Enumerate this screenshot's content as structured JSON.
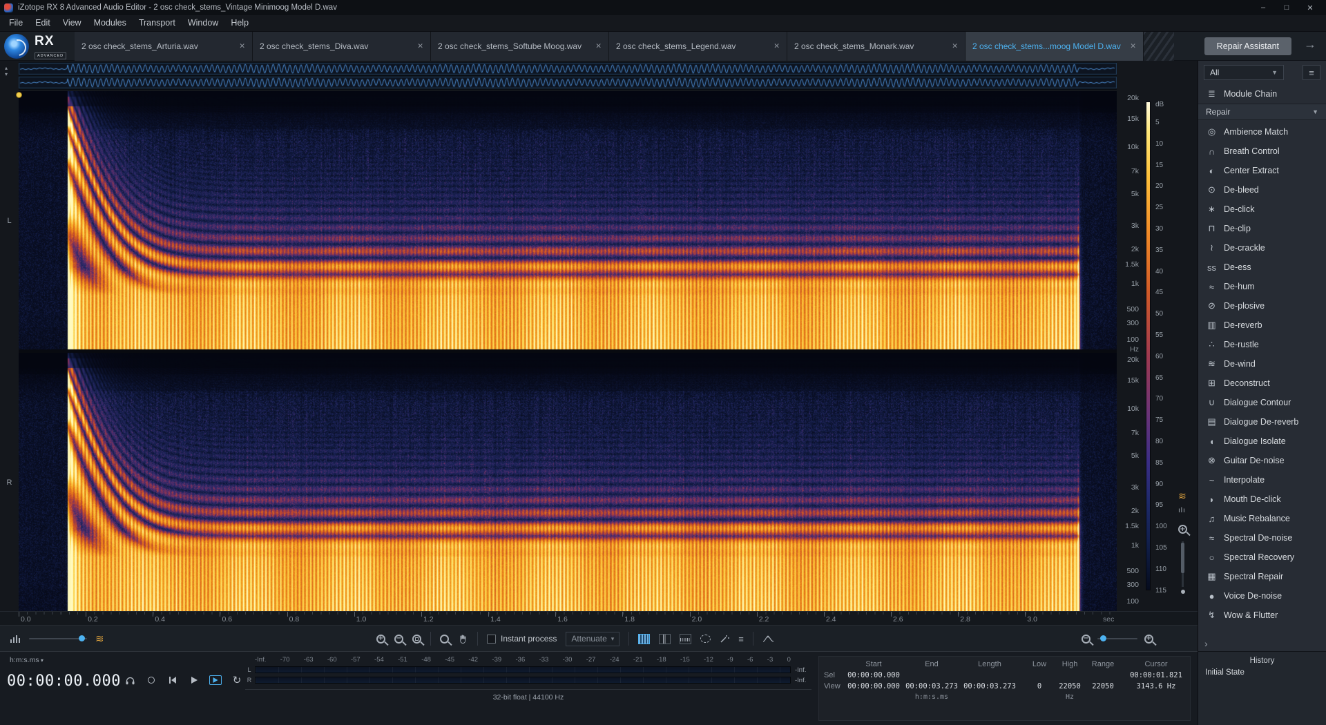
{
  "window": {
    "title": "iZotope RX 8 Advanced Audio Editor - 2 osc check_stems_Vintage Minimoog Model D.wav",
    "controls": {
      "minimize": "–",
      "maximize": "□",
      "close": "✕"
    }
  },
  "menu": {
    "items": [
      "File",
      "Edit",
      "View",
      "Modules",
      "Transport",
      "Window",
      "Help"
    ]
  },
  "brand": {
    "name": "RX",
    "sub": "ADVANCED"
  },
  "tabbar": {
    "close_glyph": "✕",
    "tabs": [
      {
        "label": "2 osc check_stems_Arturia.wav",
        "active": false
      },
      {
        "label": "2 osc check_stems_Diva.wav",
        "active": false
      },
      {
        "label": "2 osc check_stems_Softube Moog.wav",
        "active": false
      },
      {
        "label": "2 osc check_stems_Legend.wav",
        "active": false
      },
      {
        "label": "2 osc check_stems_Monark.wav",
        "active": false
      },
      {
        "label": "2 osc check_stems...moog Model D.wav",
        "active": true
      }
    ],
    "repair_assistant_label": "Repair Assistant"
  },
  "spectrogram": {
    "channel_labels": [
      "L",
      "R"
    ],
    "freq_ticks": [
      "20k",
      "15k",
      "10k",
      "7k",
      "5k",
      "3k",
      "2k",
      "1.5k",
      "1k",
      "500",
      "300",
      "100"
    ],
    "freq_tick_values": [
      20000,
      15000,
      10000,
      7000,
      5000,
      3000,
      2000,
      1500,
      1000,
      500,
      300,
      100
    ],
    "freq_unit": "Hz",
    "db_unit": "dB",
    "db_ticks": [
      5,
      10,
      15,
      20,
      25,
      30,
      35,
      40,
      45,
      50,
      55,
      60,
      65,
      70,
      75,
      80,
      85,
      90,
      95,
      100,
      105,
      110,
      115
    ],
    "time_ticks": [
      "0.0",
      "0.2",
      "0.4",
      "0.6",
      "0.8",
      "1.0",
      "1.2",
      "1.4",
      "1.6",
      "1.8",
      "2.0",
      "2.2",
      "2.4",
      "2.6",
      "2.8",
      "3.0"
    ],
    "time_unit": "sec",
    "render": {
      "duration_sec": 3.273,
      "note_on_sec": 0.146,
      "note_off_sec": 3.158,
      "fundamental_hz": 490,
      "sweep_decay_sec": 0.07,
      "pulse_rate_hz": 90,
      "max_freq_hz": 22050,
      "colormap": [
        [
          0.0,
          4,
          6,
          16
        ],
        [
          0.1,
          10,
          16,
          40
        ],
        [
          0.18,
          18,
          28,
          68
        ],
        [
          0.28,
          34,
          38,
          96
        ],
        [
          0.38,
          70,
          44,
          110
        ],
        [
          0.48,
          130,
          50,
          90
        ],
        [
          0.58,
          190,
          70,
          45
        ],
        [
          0.7,
          230,
          120,
          25
        ],
        [
          0.82,
          248,
          175,
          40
        ],
        [
          0.92,
          253,
          220,
          90
        ],
        [
          1.0,
          255,
          250,
          190
        ]
      ]
    }
  },
  "toolbar": {
    "instant_process_label": "Instant process",
    "process_mode_value": "Attenuate"
  },
  "transport": {
    "time_format": "h:m:s.ms",
    "time_display": "00:00:00.000",
    "format_info": "32-bit float | 44100 Hz",
    "buttons": [
      {
        "name": "monitor-button",
        "icon": "headphones-icon",
        "accent": false
      },
      {
        "name": "record-button",
        "icon": "record-icon",
        "accent": false
      },
      {
        "name": "skip-start-button",
        "icon": "skip-start-icon",
        "accent": false
      },
      {
        "name": "play-button",
        "icon": "play-icon",
        "accent": false
      },
      {
        "name": "play-selection-button",
        "icon": "play-selection-icon",
        "accent": true
      },
      {
        "name": "loop-button",
        "icon": "loop-icon",
        "accent": false
      },
      {
        "name": "follow-playhead-button",
        "icon": "follow-playhead-icon",
        "accent": true
      }
    ]
  },
  "meters": {
    "channels": [
      "L",
      "R"
    ],
    "value_left": "-Inf.",
    "value_right": "-Inf.",
    "ticks": [
      "-Inf.",
      "-70",
      "-63",
      "-60",
      "-57",
      "-54",
      "-51",
      "-48",
      "-45",
      "-42",
      "-39",
      "-36",
      "-33",
      "-30",
      "-27",
      "-24",
      "-21",
      "-18",
      "-15",
      "-12",
      "-9",
      "-6",
      "-3",
      "0"
    ]
  },
  "selection_info": {
    "row_labels": [
      "Sel",
      "View"
    ],
    "time_headers": [
      "Start",
      "End",
      "Length"
    ],
    "sel": {
      "start": "00:00:00.000",
      "end": "",
      "length": ""
    },
    "view": {
      "start": "00:00:00.000",
      "end": "00:00:03.273",
      "length": "00:00:03.273"
    },
    "time_unit": "h:m:s.ms",
    "freq_headers": [
      "Low",
      "High",
      "Range"
    ],
    "freq_values": [
      "0",
      "22050",
      "22050"
    ],
    "freq_unit": "Hz",
    "cursor_header": "Cursor",
    "cursor_time": "00:00:01.821",
    "cursor_freq": "3143.6 Hz"
  },
  "right_panel": {
    "filter_value": "All",
    "icons": {
      "menu": "≡",
      "chain": "≣",
      "expand": "›"
    },
    "module_chain_label": "Module Chain",
    "category": "Repair",
    "modules": [
      {
        "label": "Ambience Match",
        "glyph": "◎"
      },
      {
        "label": "Breath Control",
        "glyph": "∩"
      },
      {
        "label": "Center Extract",
        "glyph": "◐"
      },
      {
        "label": "De-bleed",
        "glyph": "⊙"
      },
      {
        "label": "De-click",
        "glyph": "∗"
      },
      {
        "label": "De-clip",
        "glyph": "⊓"
      },
      {
        "label": "De-crackle",
        "glyph": "≀"
      },
      {
        "label": "De-ess",
        "glyph": "ss"
      },
      {
        "label": "De-hum",
        "glyph": "≈"
      },
      {
        "label": "De-plosive",
        "glyph": "⊘"
      },
      {
        "label": "De-reverb",
        "glyph": "▥"
      },
      {
        "label": "De-rustle",
        "glyph": "∴"
      },
      {
        "label": "De-wind",
        "glyph": "≋"
      },
      {
        "label": "Deconstruct",
        "glyph": "⊞"
      },
      {
        "label": "Dialogue Contour",
        "glyph": "∪"
      },
      {
        "label": "Dialogue De-reverb",
        "glyph": "▤"
      },
      {
        "label": "Dialogue Isolate",
        "glyph": "◖"
      },
      {
        "label": "Guitar De-noise",
        "glyph": "⊗"
      },
      {
        "label": "Interpolate",
        "glyph": "~"
      },
      {
        "label": "Mouth De-click",
        "glyph": "◗"
      },
      {
        "label": "Music Rebalance",
        "glyph": "♫"
      },
      {
        "label": "Spectral De-noise",
        "glyph": "≈"
      },
      {
        "label": "Spectral Recovery",
        "glyph": "○"
      },
      {
        "label": "Spectral Repair",
        "glyph": "▦"
      },
      {
        "label": "Voice De-noise",
        "glyph": "●"
      },
      {
        "label": "Wow & Flutter",
        "glyph": "↯"
      }
    ],
    "history": {
      "title": "History",
      "items": [
        "Initial State"
      ]
    }
  }
}
